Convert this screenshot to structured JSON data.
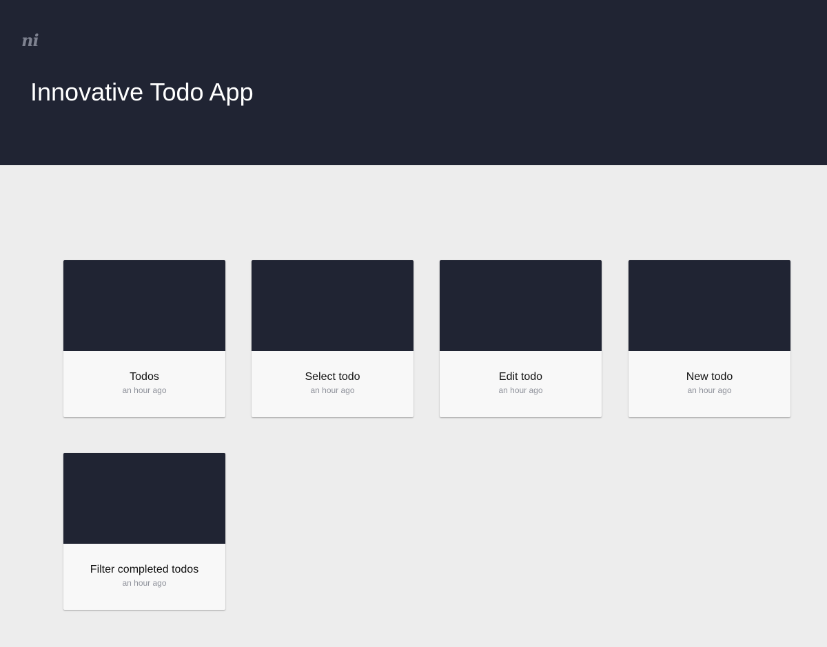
{
  "header": {
    "logo_text": "ni",
    "title": "Innovative Todo App"
  },
  "cards": [
    {
      "name": "Todos",
      "time": "an hour ago"
    },
    {
      "name": "Select todo",
      "time": "an hour ago"
    },
    {
      "name": "Edit todo",
      "time": "an hour ago"
    },
    {
      "name": "New todo",
      "time": "an hour ago"
    },
    {
      "name": "Filter completed todos",
      "time": "an hour ago"
    }
  ],
  "colors": {
    "header_background": "#202433",
    "page_background": "#ededed",
    "card_background": "#f8f8f8",
    "thumbnail": "#202433",
    "title_text": "#ffffff",
    "timestamp_text": "#8f929b"
  }
}
